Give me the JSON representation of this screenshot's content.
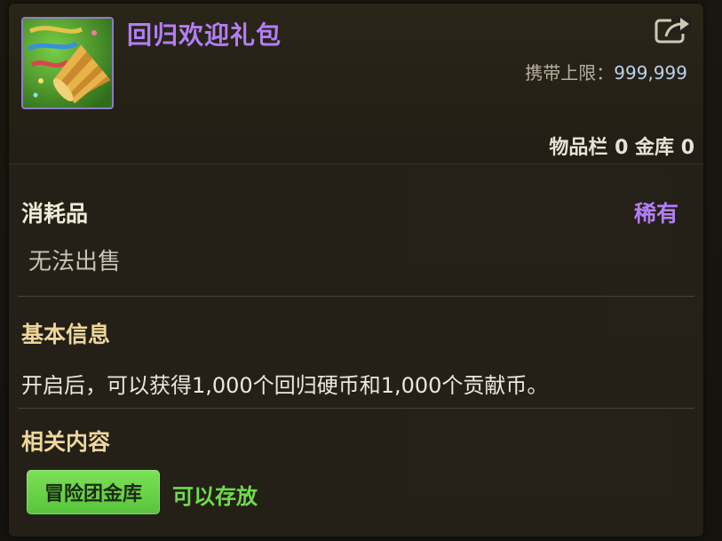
{
  "item": {
    "title": "回归欢迎礼包",
    "icon": "party-popper-icon",
    "carry_limit_label": "携带上限：",
    "carry_limit_value": "999,999",
    "storage_text": "物品栏 0 金库 0"
  },
  "details": {
    "category": "消耗品",
    "rarity": "稀有",
    "sell_status": "无法出售"
  },
  "basic_info": {
    "title": "基本信息",
    "description": "开启后，可以获得1,000个回归硬币和1,000个贡献币。"
  },
  "related": {
    "title": "相关内容",
    "button_label": "冒险团金库",
    "status": "可以存放"
  },
  "colors": {
    "title_purple": "#b27ef6",
    "section_gold": "#eed79a",
    "green_button": "#6bd14c",
    "green_text": "#6edc4a"
  }
}
